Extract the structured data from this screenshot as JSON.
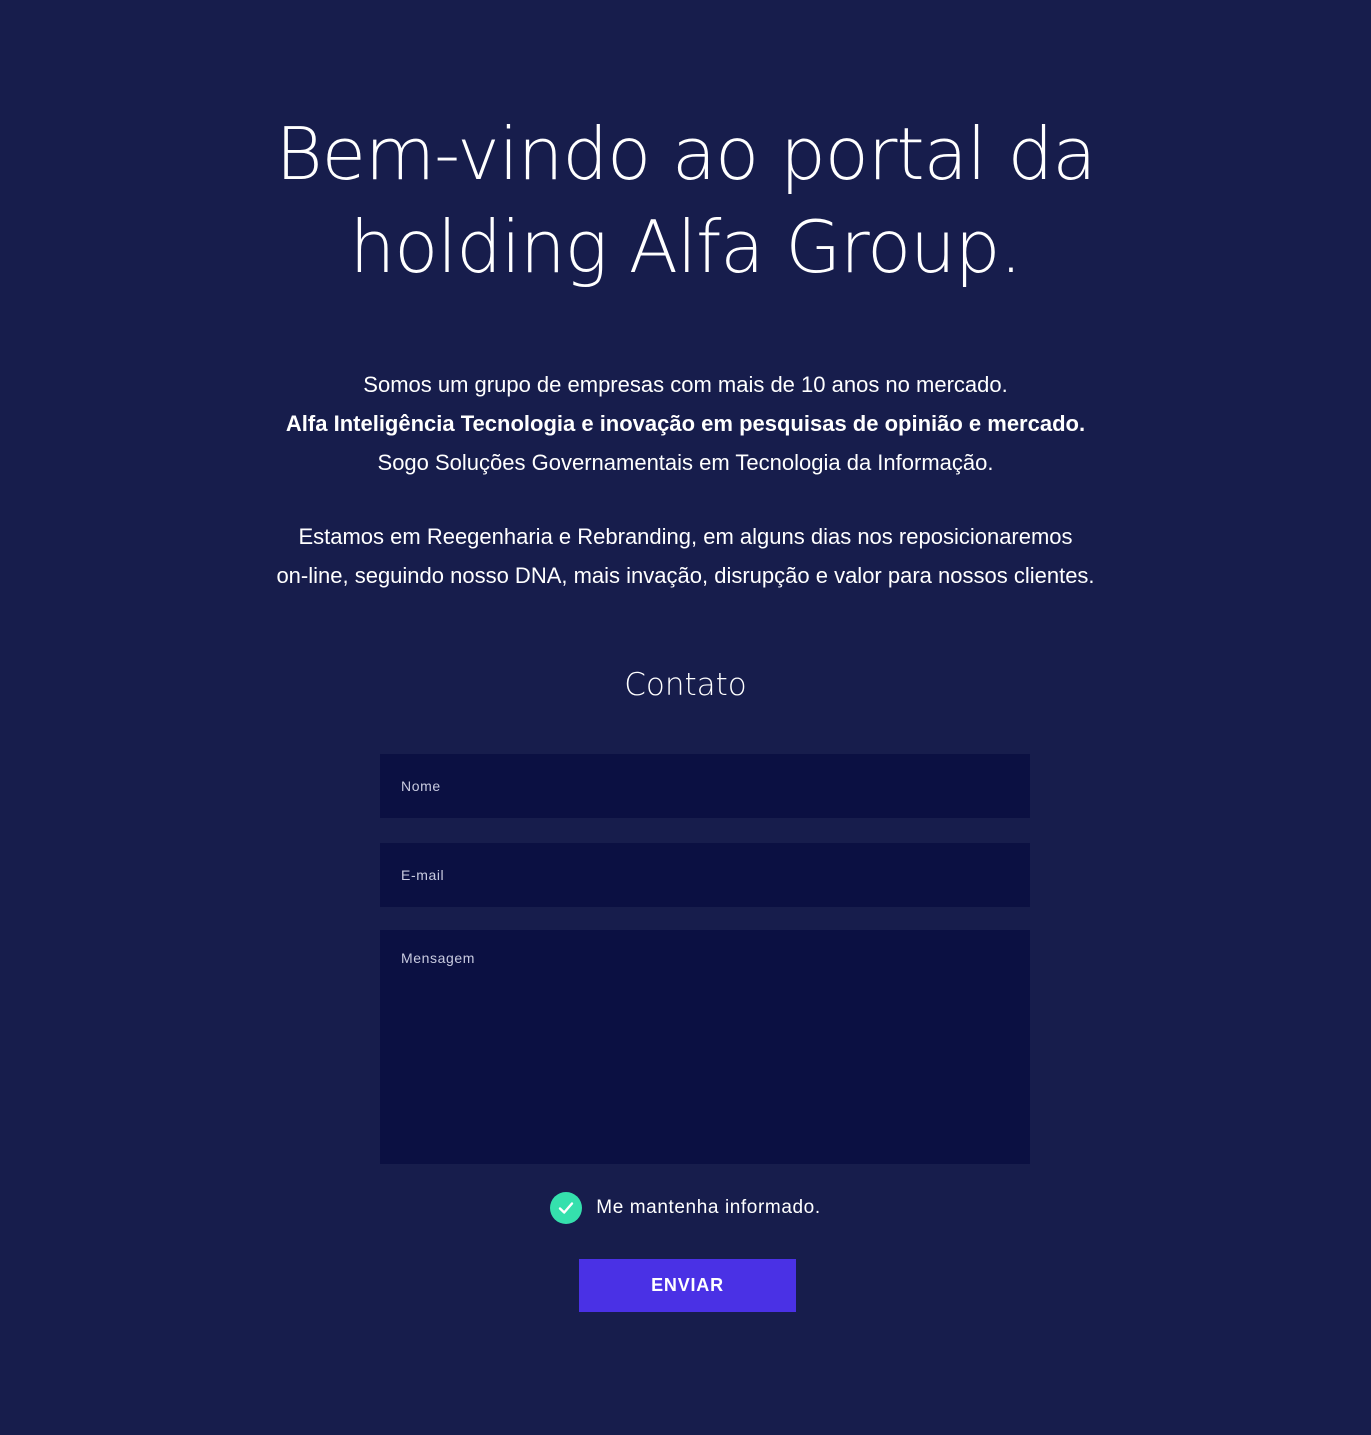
{
  "hero": {
    "title_line1": "Bem-vindo ao portal da",
    "title_line2": "holding Alfa Group."
  },
  "intro": {
    "line1": "Somos um grupo de empresas com mais de 10 anos no mercado.",
    "line2": "Alfa Inteligência Tecnologia e inovação em pesquisas de opinião e mercado.",
    "line3": "Sogo Soluções Governamentais em Tecnologia da Informação."
  },
  "notice": {
    "line1": "Estamos em Reegenharia e Rebranding, em alguns dias nos reposicionaremos",
    "line2": "on-line, seguindo nosso DNA,  mais invação, disrupção e valor para nossos clientes."
  },
  "contact": {
    "heading": "Contato",
    "name_placeholder": "Nome",
    "email_placeholder": "E-mail",
    "message_placeholder": "Mensagem",
    "newsletter_label": "Me mantenha informado.",
    "newsletter_checked": true,
    "submit_label": "ENVIAR"
  },
  "colors": {
    "background": "#171d4c",
    "field_background": "#0b1042",
    "accent_button": "#4a31e5",
    "check_green": "#35e0ad"
  },
  "icons": {
    "checkbox": "check-icon"
  }
}
